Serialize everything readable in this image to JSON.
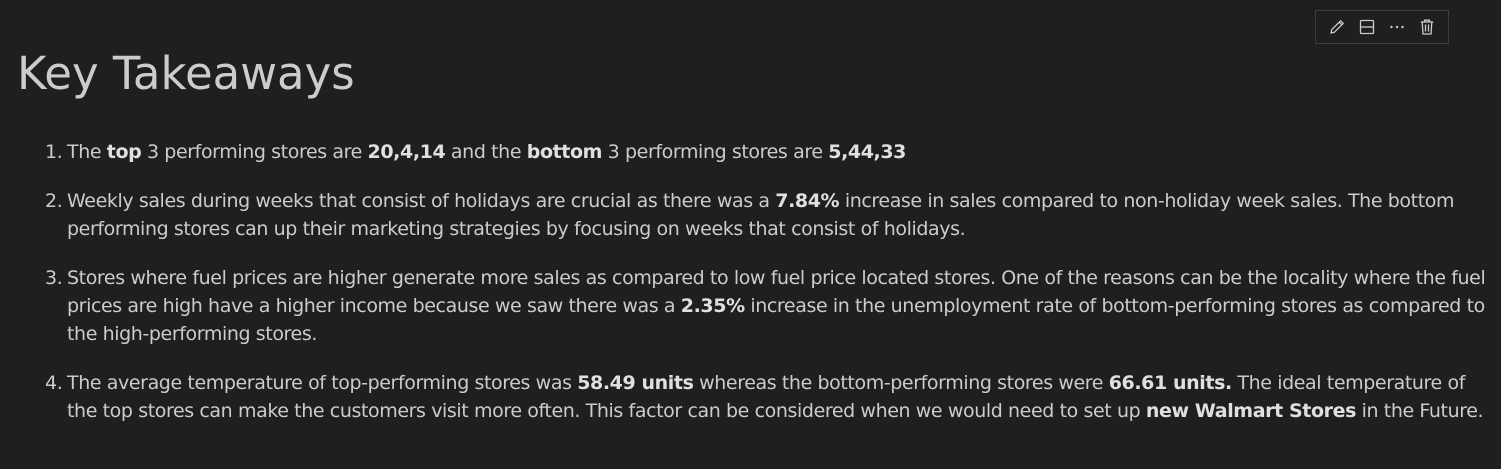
{
  "toolbar": {
    "icons": [
      "edit-pencil-icon",
      "split-cell-icon",
      "more-actions-icon",
      "delete-trash-icon"
    ]
  },
  "heading": "Key Takeaways",
  "items": [
    {
      "num": "1.",
      "s0": "The ",
      "b0": "top",
      "s1": " 3 performing stores are ",
      "b1": "20,4,14",
      "s2": " and the ",
      "b2": "bottom",
      "s3": " 3 performing stores are ",
      "b3": "5,44,33"
    },
    {
      "num": "2.",
      "s0": "Weekly sales during weeks that consist of holidays are crucial as there was a ",
      "b0": "7.84%",
      "s1": " increase in sales compared to non-holiday week sales. The bottom performing stores can up their marketing strategies by focusing on weeks that consist of holidays."
    },
    {
      "num": "3.",
      "s0": "Stores where fuel prices are higher generate more sales as compared to low fuel price located stores. One of the reasons can be the locality where the fuel prices are high have a higher income because we saw there was a ",
      "b0": "2.35%",
      "s1": " increase in the unemployment rate of bottom-performing stores as compared to the high-performing stores."
    },
    {
      "num": "4.",
      "s0": "The average temperature of top-performing stores was ",
      "b0": "58.49 units",
      "s1": " whereas the bottom-performing stores were ",
      "b1": "66.61 units.",
      "s2": " The ideal temperature of the top stores can make the customers visit more often. This factor can be considered when we would need to set up ",
      "b2": "new Walmart Stores",
      "s3": " in the Future."
    }
  ]
}
